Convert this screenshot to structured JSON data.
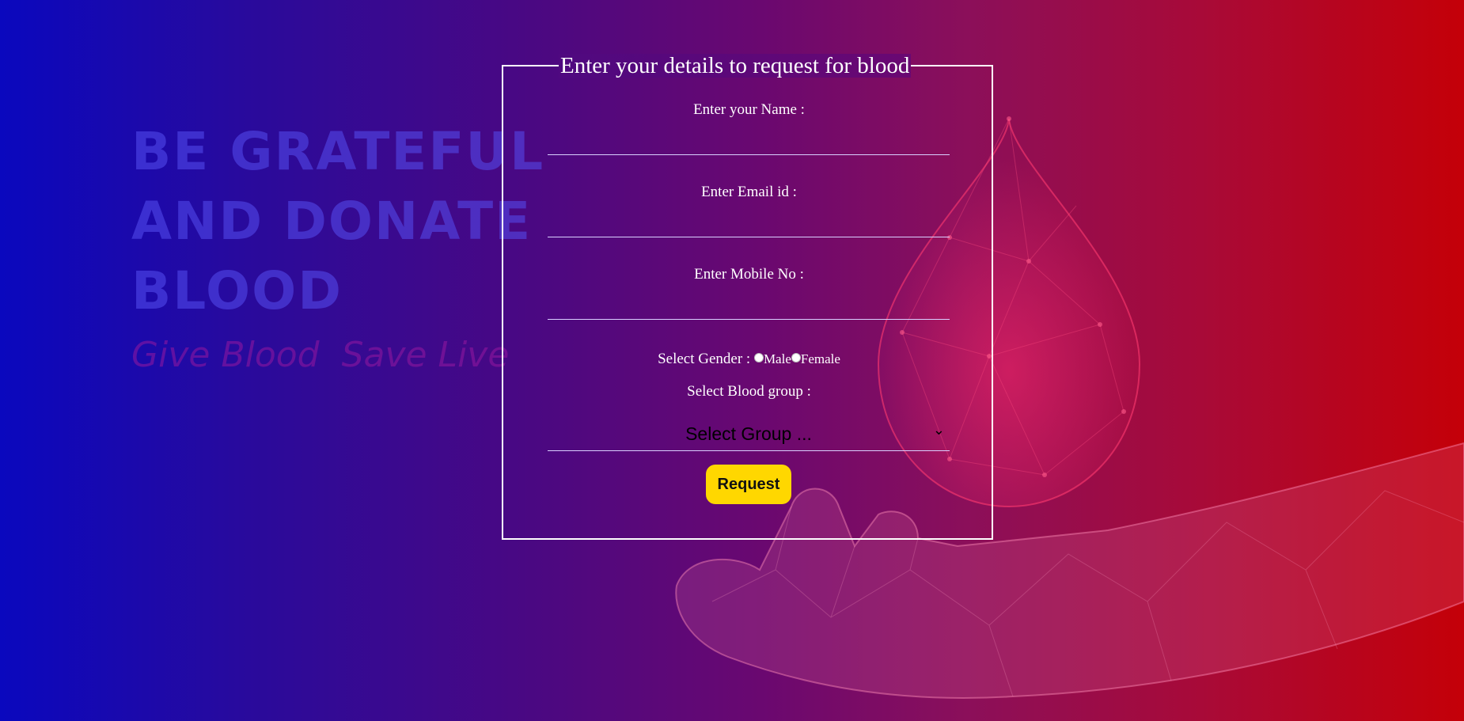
{
  "background": {
    "slogan": "BE GRATEFUL\nAND DONATE\nBLOOD",
    "tagline": "Give Blood  Save Live"
  },
  "form": {
    "legend": "Enter your details to request for blood",
    "name_label": "Enter your Name :",
    "email_label": "Enter Email id :",
    "mobile_label": "Enter Mobile No :",
    "gender_label": "Select Gender :",
    "gender_options": [
      "Male",
      "Female"
    ],
    "blood_group_label": "Select Blood group :",
    "blood_group_selected": "Select Group ...",
    "submit_label": "Request"
  },
  "colors": {
    "gradient_left": "#0a08be",
    "gradient_right": "#c40008",
    "button": "#ffd700",
    "text": "#ffffff"
  }
}
